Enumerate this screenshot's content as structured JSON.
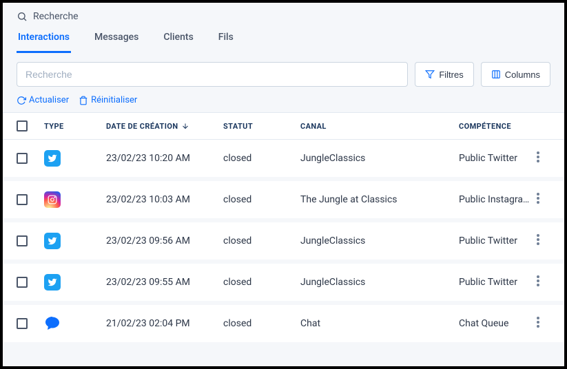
{
  "searchLabel": "Recherche",
  "tabs": [
    {
      "label": "Interactions",
      "active": true
    },
    {
      "label": "Messages",
      "active": false
    },
    {
      "label": "Clients",
      "active": false
    },
    {
      "label": "Fils",
      "active": false
    }
  ],
  "searchPlaceholder": "Recherche",
  "filtersLabel": "Filtres",
  "columnsLabel": "Columns",
  "refreshLabel": "Actualiser",
  "resetLabel": "Réinitialiser",
  "headers": {
    "type": "TYPE",
    "date": "DATE DE CRÉATION",
    "status": "STATUT",
    "canal": "CANAL",
    "competence": "COMPÉTENCE"
  },
  "rows": [
    {
      "type": "twitter",
      "date": "23/02/23 10:20 AM",
      "status": "closed",
      "canal": "JungleClassics",
      "competence": "Public Twitter"
    },
    {
      "type": "instagram",
      "date": "23/02/23 10:03 AM",
      "status": "closed",
      "canal": "The Jungle at Classics",
      "competence": "Public Instagra…"
    },
    {
      "type": "twitter",
      "date": "23/02/23 09:56 AM",
      "status": "closed",
      "canal": "JungleClassics",
      "competence": "Public Twitter"
    },
    {
      "type": "twitter",
      "date": "23/02/23 09:55 AM",
      "status": "closed",
      "canal": "JungleClassics",
      "competence": "Public Twitter"
    },
    {
      "type": "chat",
      "date": "21/02/23 02:04 PM",
      "status": "closed",
      "canal": "Chat",
      "competence": "Chat Queue"
    }
  ]
}
